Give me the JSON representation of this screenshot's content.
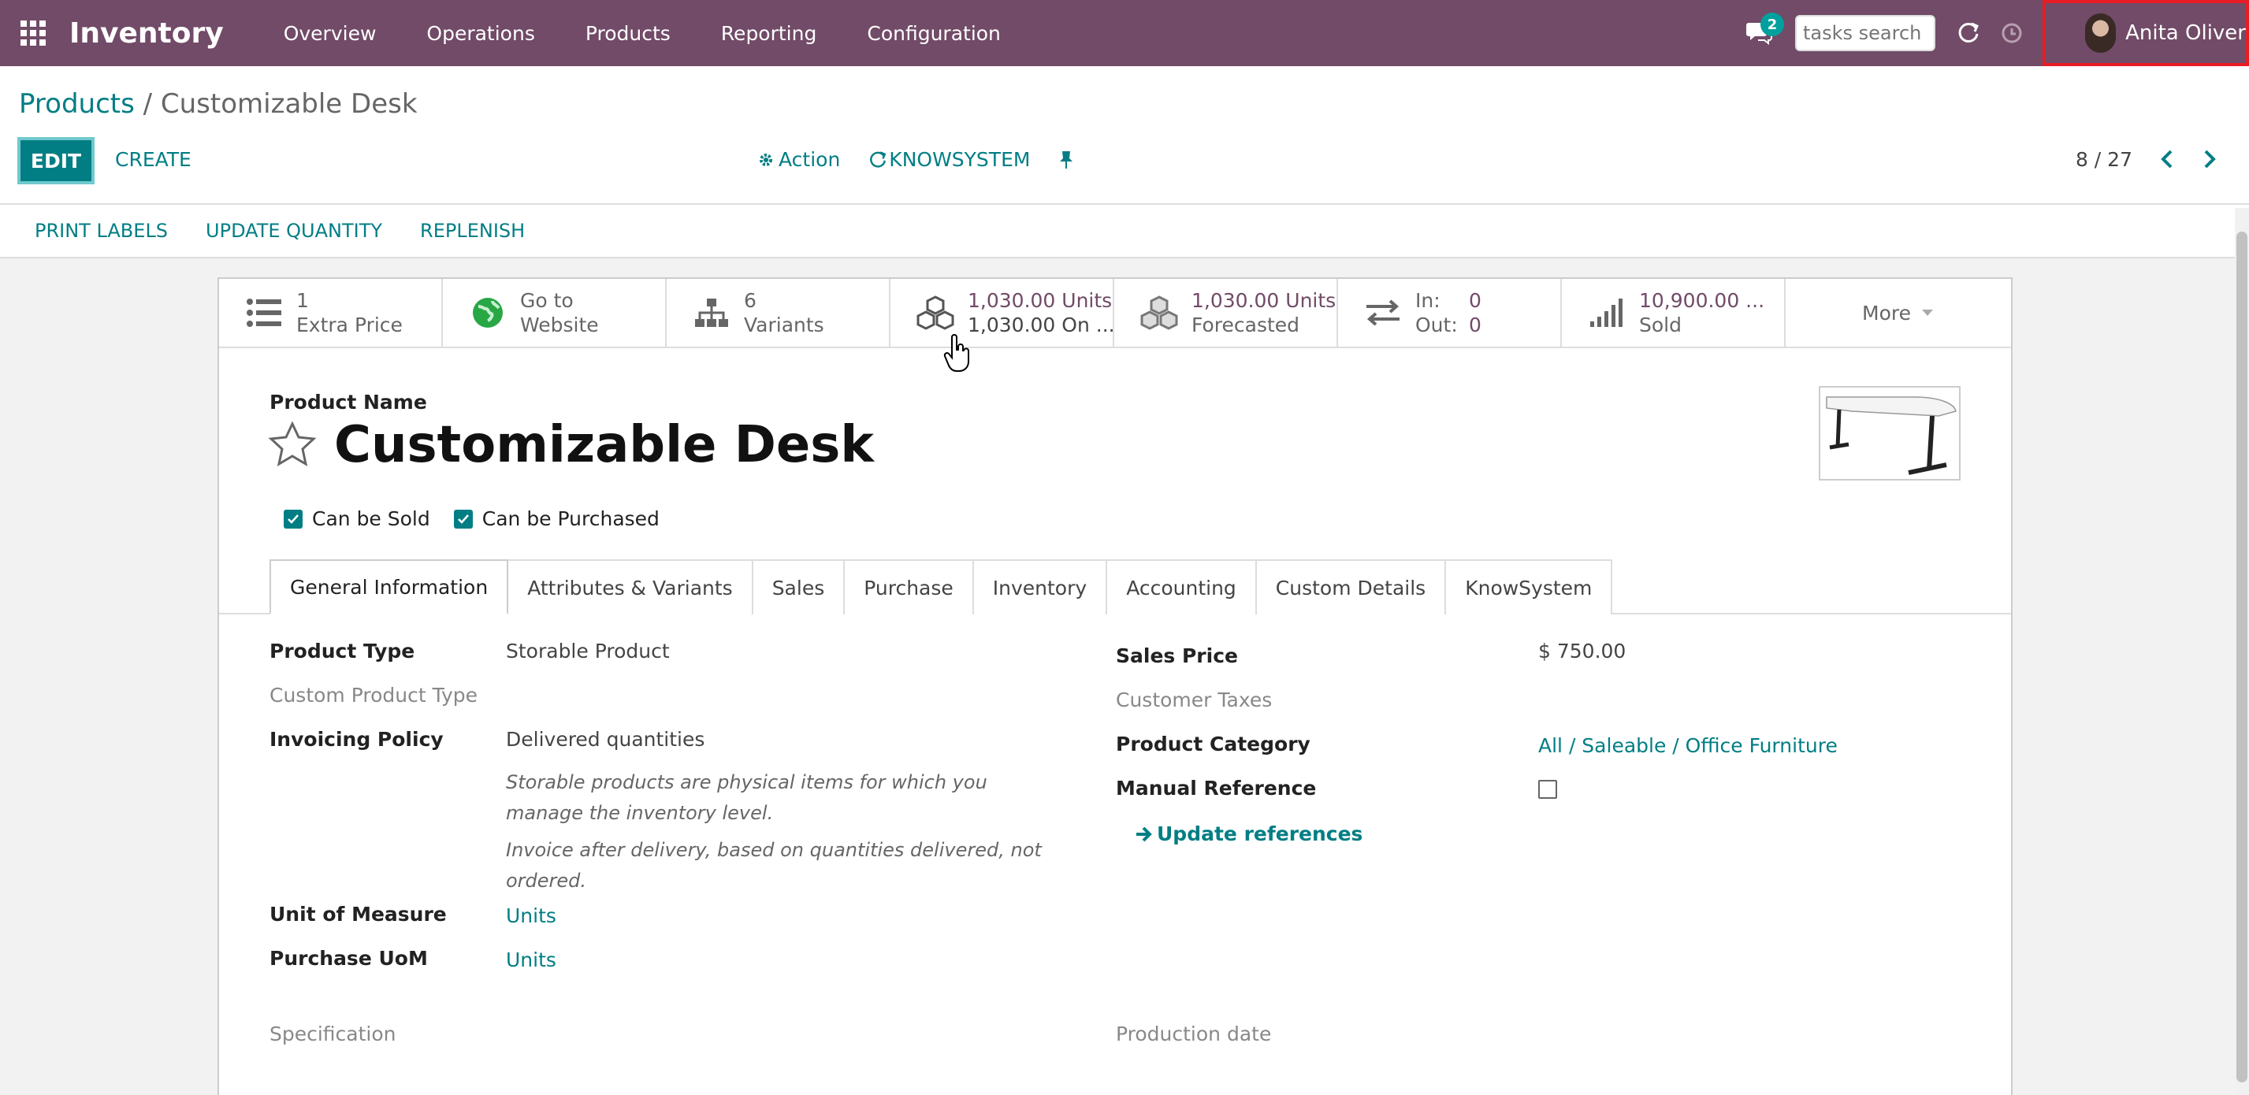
{
  "topnav": {
    "app_name": "Inventory",
    "menu": [
      "Overview",
      "Operations",
      "Products",
      "Reporting",
      "Configuration"
    ],
    "chat_count": "2",
    "search_placeholder": "tasks search",
    "user_name": "Anita Oliver"
  },
  "control": {
    "breadcrumb_parent": "Products",
    "breadcrumb_sep": " / ",
    "breadcrumb_current": "Customizable Desk",
    "edit_label": "EDIT",
    "create_label": "CREATE",
    "action_label": "Action",
    "knowsystem_label": "KNOWSYSTEM",
    "pager": "8 / 27"
  },
  "statusbar": {
    "buttons": [
      "PRINT LABELS",
      "UPDATE QUANTITY",
      "REPLENISH"
    ]
  },
  "smart_buttons": {
    "extra_price": {
      "value": "1",
      "label": "Extra Price"
    },
    "website": {
      "line1": "Go to",
      "line2": "Website"
    },
    "variants": {
      "value": "6",
      "label": "Variants"
    },
    "on_hand": {
      "line1": "1,030.00 Units",
      "line2": "1,030.00 On ..."
    },
    "forecasted": {
      "line1": "1,030.00 Units",
      "line2": "Forecasted"
    },
    "inout": {
      "in_label": "In:",
      "in_value": "0",
      "out_label": "Out:",
      "out_value": "0"
    },
    "sold": {
      "line1": "10,900.00 ...",
      "line2": "Sold"
    },
    "more": "More"
  },
  "product": {
    "name_label": "Product Name",
    "name": "Customizable Desk",
    "can_be_sold": "Can be Sold",
    "can_be_purchased": "Can be Purchased"
  },
  "tabs": [
    "General Information",
    "Attributes & Variants",
    "Sales",
    "Purchase",
    "Inventory",
    "Accounting",
    "Custom Details",
    "KnowSystem"
  ],
  "general": {
    "product_type_label": "Product Type",
    "product_type": "Storable Product",
    "custom_product_type_label": "Custom Product Type",
    "invoicing_policy_label": "Invoicing Policy",
    "invoicing_policy": "Delivered quantities",
    "help_storable": "Storable products are physical items for which you manage the inventory level.",
    "help_invoice": "Invoice after delivery, based on quantities delivered, not ordered.",
    "uom_label": "Unit of Measure",
    "uom": "Units",
    "purchase_uom_label": "Purchase UoM",
    "purchase_uom": "Units",
    "specification_label": "Specification",
    "sales_price_label": "Sales Price",
    "sales_price": "$ 750.00",
    "customer_taxes_label": "Customer Taxes",
    "product_category_label": "Product Category",
    "product_category": "All / Saleable / Office Furniture",
    "manual_reference_label": "Manual Reference",
    "update_references": "Update references",
    "production_date_label": "Production date"
  },
  "colors": {
    "brand": "#714b67",
    "accent": "#017e84",
    "highlight": "#e81c24"
  }
}
